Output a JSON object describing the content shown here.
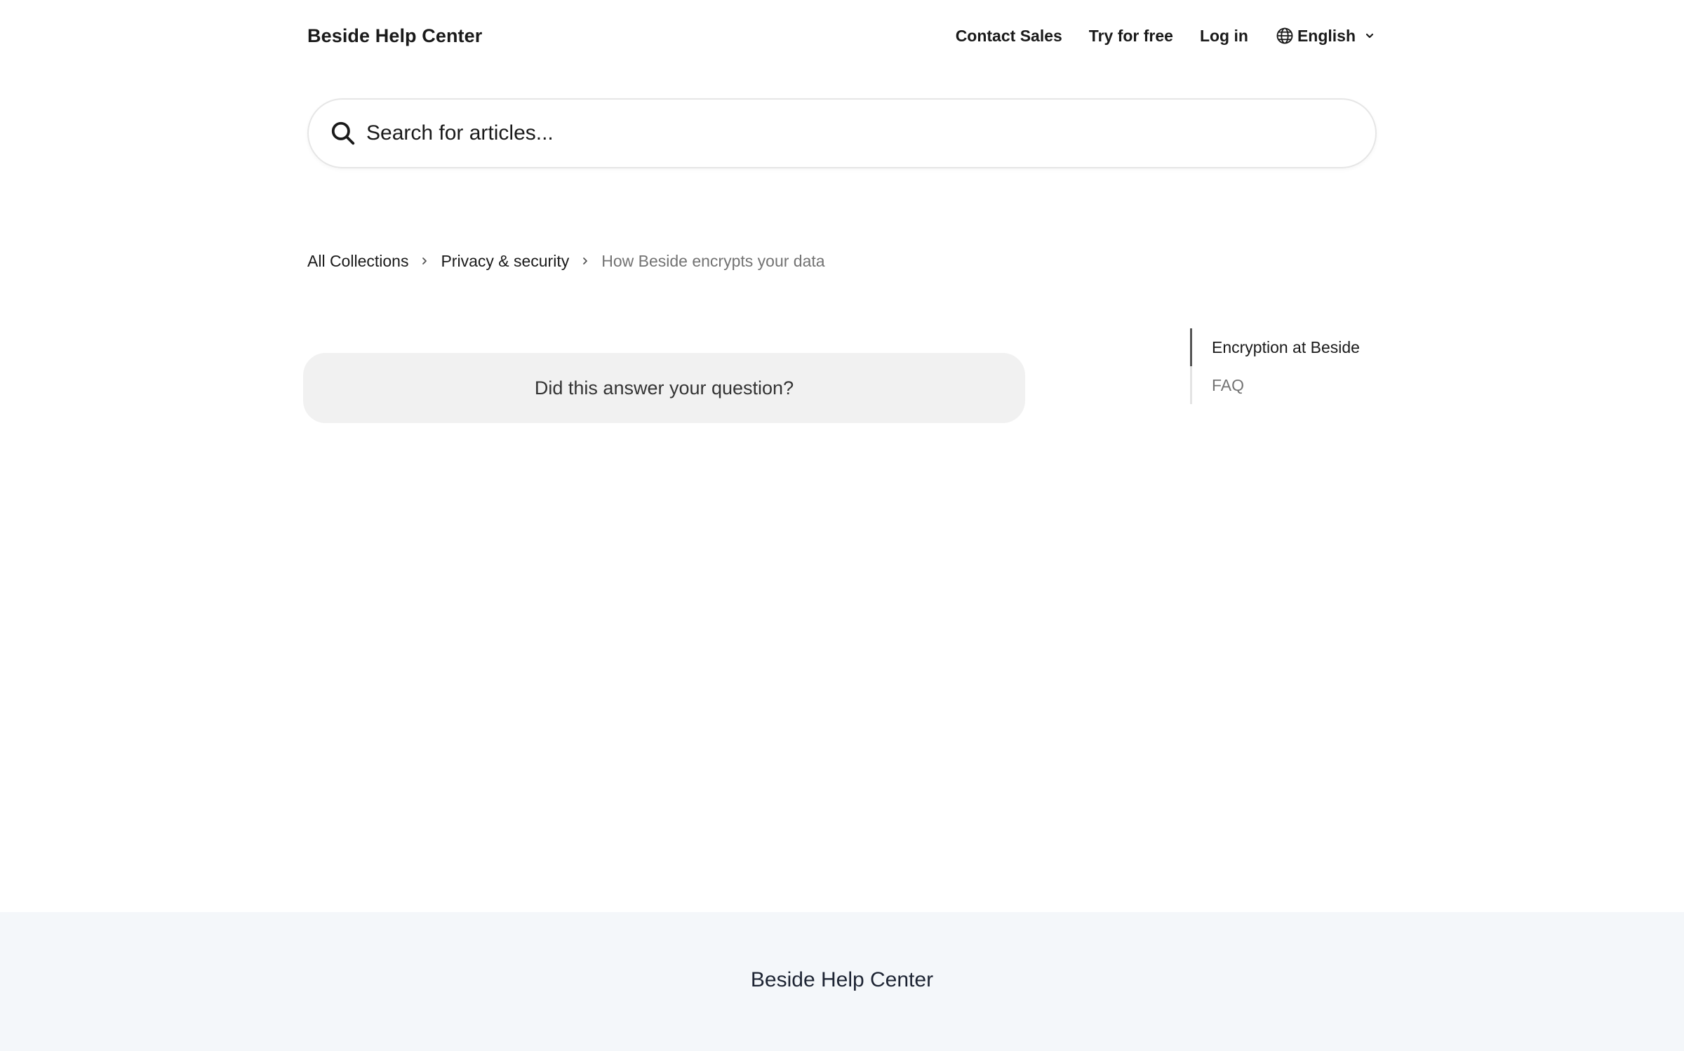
{
  "header": {
    "brand": "Beside Help Center",
    "nav": {
      "contact_sales": "Contact Sales",
      "try_for_free": "Try for free",
      "log_in": "Log in"
    },
    "language": {
      "selected": "English",
      "icon": "globe-icon"
    }
  },
  "search": {
    "placeholder": "Search for articles...",
    "value": "",
    "icon": "search-icon"
  },
  "breadcrumb": {
    "items": [
      "All Collections",
      "Privacy & security"
    ],
    "current": "How Beside encrypts your data"
  },
  "feedback": {
    "question": "Did this answer your question?"
  },
  "toc": {
    "items": [
      {
        "label": "Encryption at Beside",
        "active": true
      },
      {
        "label": "FAQ",
        "active": false
      }
    ]
  },
  "footer": {
    "brand": "Beside Help Center"
  },
  "colors": {
    "text": "#1a1a1a",
    "muted": "#737373",
    "feedback_bg": "#f1f1f1",
    "footer_bg": "#f4f7fa",
    "toc_active_bar": "#555555"
  }
}
